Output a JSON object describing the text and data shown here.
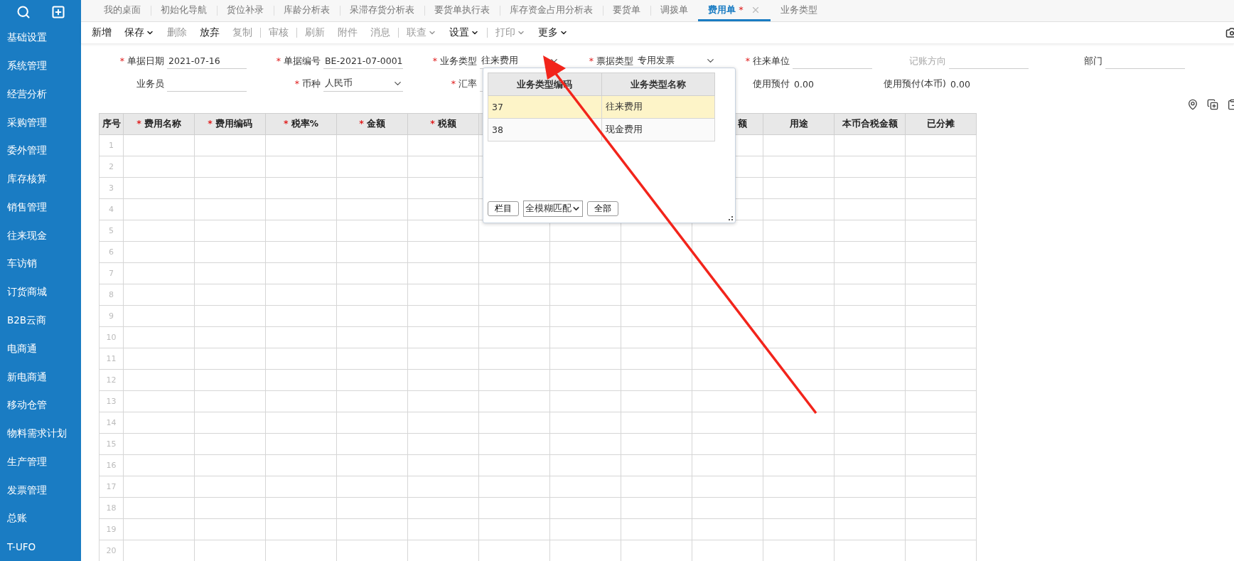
{
  "sidebar": {
    "items": [
      {
        "label": "基础设置"
      },
      {
        "label": "系统管理"
      },
      {
        "label": "经营分析"
      },
      {
        "label": "采购管理"
      },
      {
        "label": "委外管理"
      },
      {
        "label": "库存核算"
      },
      {
        "label": "销售管理"
      },
      {
        "label": "往来现金"
      },
      {
        "label": "车访销"
      },
      {
        "label": "订货商城"
      },
      {
        "label": "B2B云商"
      },
      {
        "label": "电商通"
      },
      {
        "label": "新电商通"
      },
      {
        "label": "移动仓管"
      },
      {
        "label": "物料需求计划"
      },
      {
        "label": "生产管理"
      },
      {
        "label": "发票管理"
      },
      {
        "label": "总账"
      },
      {
        "label": "T-UFO"
      }
    ]
  },
  "tabs": [
    {
      "label": "我的桌面",
      "selected": false
    },
    {
      "label": "初始化导航",
      "selected": false
    },
    {
      "label": "货位补录",
      "selected": false
    },
    {
      "label": "库龄分析表",
      "selected": false
    },
    {
      "label": "呆滞存货分析表",
      "selected": false
    },
    {
      "label": "要货单执行表",
      "selected": false
    },
    {
      "label": "库存资金占用分析表",
      "selected": false
    },
    {
      "label": "要货单",
      "selected": false
    },
    {
      "label": "调拨单",
      "selected": false
    },
    {
      "label": "费用单",
      "selected": true,
      "marker": "*",
      "closable": true
    },
    {
      "label": "业务类型",
      "selected": false
    }
  ],
  "toolbar": [
    [
      {
        "label": "新增",
        "disabled": false,
        "dropdown": false
      },
      {
        "label": "保存",
        "disabled": false,
        "dropdown": true
      },
      {
        "label": "删除",
        "disabled": true,
        "dropdown": false
      },
      {
        "label": "放弃",
        "disabled": false,
        "dropdown": false
      },
      {
        "label": "复制",
        "disabled": true,
        "dropdown": false
      }
    ],
    [
      {
        "label": "审核",
        "disabled": true,
        "dropdown": false
      }
    ],
    [
      {
        "label": "刷新",
        "disabled": true,
        "dropdown": false
      },
      {
        "label": "附件",
        "disabled": true,
        "dropdown": false
      },
      {
        "label": "消息",
        "disabled": true,
        "dropdown": false
      }
    ],
    [
      {
        "label": "联查",
        "disabled": true,
        "dropdown": true
      },
      {
        "label": "设置",
        "disabled": false,
        "dropdown": true
      }
    ],
    [
      {
        "label": "打印",
        "disabled": true,
        "dropdown": true
      },
      {
        "label": "更多",
        "disabled": false,
        "dropdown": true
      }
    ]
  ],
  "form": [
    [
      {
        "kind": "text",
        "label": "单据日期",
        "required": "*",
        "value": "2021-07-16",
        "disabled": false
      },
      {
        "kind": "text",
        "label": "单据编号",
        "required": "*",
        "value": "BE-2021-07-0001",
        "disabled": false
      },
      {
        "kind": "select",
        "label": "业务类型",
        "required": "*",
        "value": "往来费用",
        "disabled": false
      },
      {
        "kind": "select",
        "label": "票据类型",
        "required": "*",
        "value": "专用发票",
        "disabled": false
      },
      {
        "kind": "text",
        "label": "往来单位",
        "required": "*",
        "disabled": false
      },
      {
        "kind": "text",
        "label": "记账方向",
        "disabled": true
      },
      {
        "kind": "text",
        "label": "部门",
        "disabled": false
      }
    ],
    [
      {
        "kind": "text",
        "label": "业务员",
        "disabled": false
      },
      {
        "kind": "select",
        "label": "币种",
        "required": "*",
        "value": "人民币",
        "disabled": false
      },
      {
        "kind": "text",
        "label": "汇率",
        "required": "*",
        "disabled": false
      },
      {
        "kind": "blank"
      },
      {
        "kind": "plain",
        "label": "使用预付",
        "value": "0.00",
        "disabled": false
      },
      {
        "kind": "plain",
        "label": "使用预付(本币)",
        "value": "0.00",
        "disabled": false
      }
    ]
  ],
  "table": {
    "columns": [
      {
        "label": "序号"
      },
      {
        "label": "费用名称",
        "required": "*"
      },
      {
        "label": "费用编码",
        "required": "*"
      },
      {
        "label": "税率%",
        "required": "*"
      },
      {
        "label": "金额",
        "required": "*"
      },
      {
        "label": "税额",
        "required": "*"
      },
      {},
      {},
      {},
      {
        "label": "额",
        "clipped": true
      },
      {
        "label": "用途"
      },
      {
        "label": "本币合税金额"
      },
      {
        "label": "已分摊"
      }
    ],
    "rows": [
      {
        "number": "1"
      },
      {
        "number": "2"
      },
      {
        "number": "3"
      },
      {
        "number": "4"
      },
      {
        "number": "5"
      },
      {
        "number": "6"
      },
      {
        "number": "7"
      },
      {
        "number": "8"
      },
      {
        "number": "9"
      },
      {
        "number": "10"
      },
      {
        "number": "11"
      },
      {
        "number": "12"
      },
      {
        "number": "13"
      },
      {
        "number": "14"
      },
      {
        "number": "15"
      },
      {
        "number": "16"
      },
      {
        "number": "17"
      },
      {
        "number": "18"
      },
      {
        "number": "19"
      },
      {
        "number": "20"
      }
    ]
  },
  "popup": {
    "columns": [
      "业务类型编码",
      "业务类型名称"
    ],
    "rows": [
      {
        "code": "37",
        "name": "往来费用",
        "selected": true
      },
      {
        "code": "38",
        "name": "现金费用",
        "selected": false
      }
    ],
    "column_button": "栏目",
    "match_mode": "全模糊匹配",
    "all_button": "全部"
  }
}
